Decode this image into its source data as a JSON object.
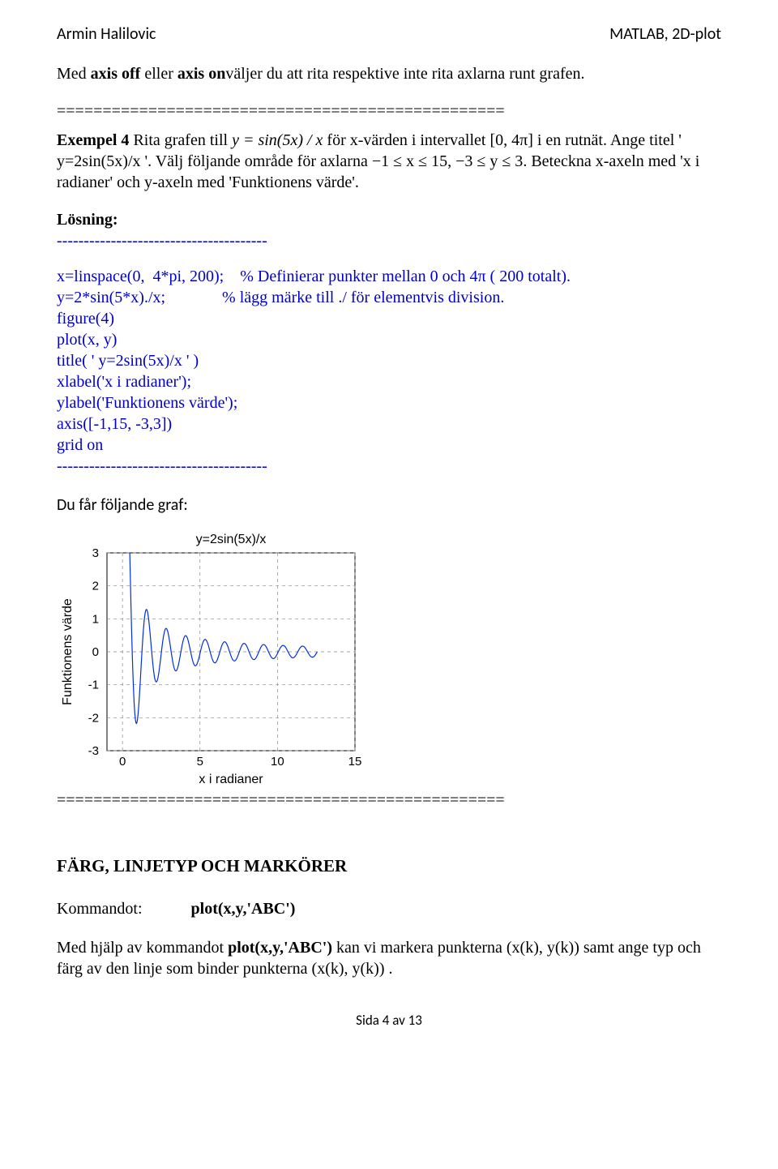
{
  "header": {
    "left": "Armin Halilovic",
    "right": "MATLAB, 2D-plot"
  },
  "body": {
    "line1_pre": "Med ",
    "line1_bold1": "axis off",
    "line1_mid1": " eller ",
    "line1_bold2": "axis on",
    "line1_post": "väljer du att rita respektive inte rita axlarna runt grafen.",
    "sep1": "=================================================",
    "ex4_pre": "Exempel 4 ",
    "ex4_text1": "Rita grafen till ",
    "ex4_formula": "y = sin(5x) / x",
    "ex4_text2": " för x-värden  i intervallet [0, 4π] i en rutnät. Ange titel ' y=2sin(5x)/x '. Välj följande område för axlarna  ",
    "ex4_range": "−1 ≤ x ≤ 15,  −3 ≤ y ≤ 3",
    "ex4_text3": ". Beteckna x-axeln med 'x i radianer' och y-axeln med 'Funktionens värde'.",
    "losning": "Lösning:",
    "dash1": "---------------------------------------",
    "code1": "x=linspace(0,  4*pi, 200);    % Definierar punkter mellan 0 och 4π ( 200 totalt).",
    "code2": "y=2*sin(5*x)./x;              % lägg märke till ./ för elementvis division.",
    "code3": "figure(4)",
    "code4": "plot(x, y)",
    "code5": "title( ' y=2sin(5x)/x ' )",
    "code6": "xlabel('x i radianer');",
    "code7": "ylabel('Funktionens värde');",
    "code8": "axis([-1,15, -3,3])",
    "code9": "grid on",
    "dash2": "---------------------------------------",
    "graf_intro": "Du får följande graf:",
    "sep2": "=================================================",
    "section_title": "FÄRG, LINJETYP OCH MARKÖRER",
    "kommandot": "Kommandot:",
    "kommandot_cmd": "plot(x,y,'ABC')",
    "desc_pre": "Med hjälp av kommandot ",
    "desc_bold": "plot(x,y,'ABC')",
    "desc_post": " kan vi markera punkterna (x(k), y(k)) samt ange typ och färg av den linje som binder punkterna (x(k), y(k)) ."
  },
  "chart_data": {
    "type": "line",
    "title": "y=2sin(5x)/x",
    "xlabel": "x i radianer",
    "ylabel": "Funktionens värde",
    "xlim": [
      -1,
      15
    ],
    "ylim": [
      -3,
      3
    ],
    "xticks": [
      0,
      5,
      10,
      15
    ],
    "yticks": [
      -3,
      -2,
      -1,
      0,
      1,
      2,
      3
    ],
    "grid": true,
    "series": [
      {
        "name": "y=2sin(5x)/x",
        "note": "y = 2*sin(5x)/x over x in [0, 4π], 200 points"
      }
    ]
  },
  "footer": {
    "page": "Sida 4 av 13"
  }
}
